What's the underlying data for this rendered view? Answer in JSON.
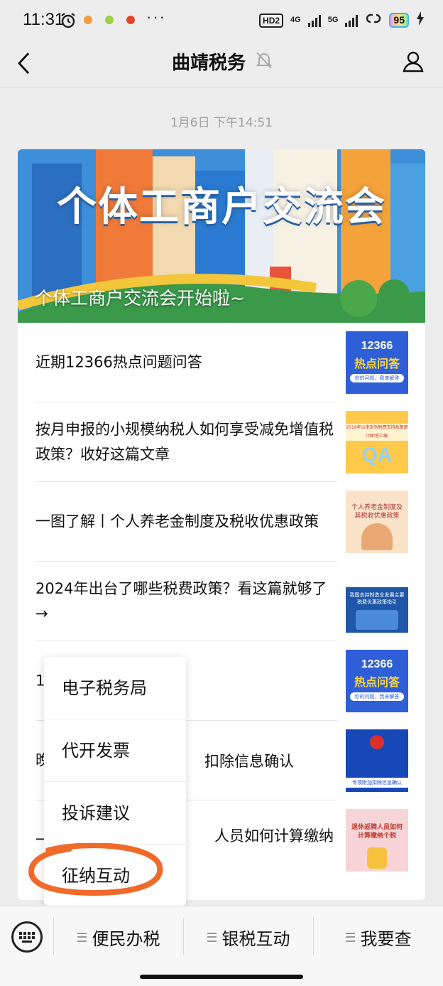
{
  "status_bar": {
    "time": "11:31",
    "more": "···",
    "hd": "HD2",
    "net1": "4G",
    "net2": "5G",
    "battery": "95"
  },
  "nav": {
    "title": "曲靖税务"
  },
  "timestamp": "1月6日 下午14:51",
  "banner": {
    "image_title": "个体工商户交流会",
    "caption": "个体工商户交流会开始啦~"
  },
  "articles": [
    {
      "title": "近期12366热点问题问答",
      "thumb": {
        "line1": "12366",
        "line2": "热点问答",
        "line3": "你的问题，我来解答"
      }
    },
    {
      "title": "按月申报的小规模纳税人如何享受减免增值税政策？收好这篇文章",
      "thumb": {
        "band": "2019年以来系列税费支持政策即问即答汇编",
        "big": "QA"
      }
    },
    {
      "title": "一图了解丨个人养老金制度及税收优惠政策",
      "thumb": {
        "text": "个人养老金制度及其税收优惠政策"
      }
    },
    {
      "title": "2024年出台了哪些税费政策？看这篇就够了→",
      "thumb": {
        "text": "我国支持制造业发展主要税费优惠政策指引"
      }
    },
    {
      "title": "1",
      "thumb": {
        "line1": "12366",
        "line2": "热点问答",
        "line3": "你的问题，我来解答"
      }
    },
    {
      "title": "晚",
      "title_tail": "扣除信息确认",
      "thumb": {
        "bar": "专项附加扣除信息确认"
      }
    },
    {
      "title": "一",
      "title_tail": "人员如何计算缴纳",
      "thumb": {
        "text": "退休返聘人员如何计算缴纳个税"
      }
    }
  ],
  "popup_menu": {
    "items": [
      "电子税务局",
      "代开发票",
      "投诉建议",
      "征纳互动"
    ]
  },
  "bottom_menu": {
    "items": [
      "便民办税",
      "银税互动",
      "我要查"
    ]
  }
}
